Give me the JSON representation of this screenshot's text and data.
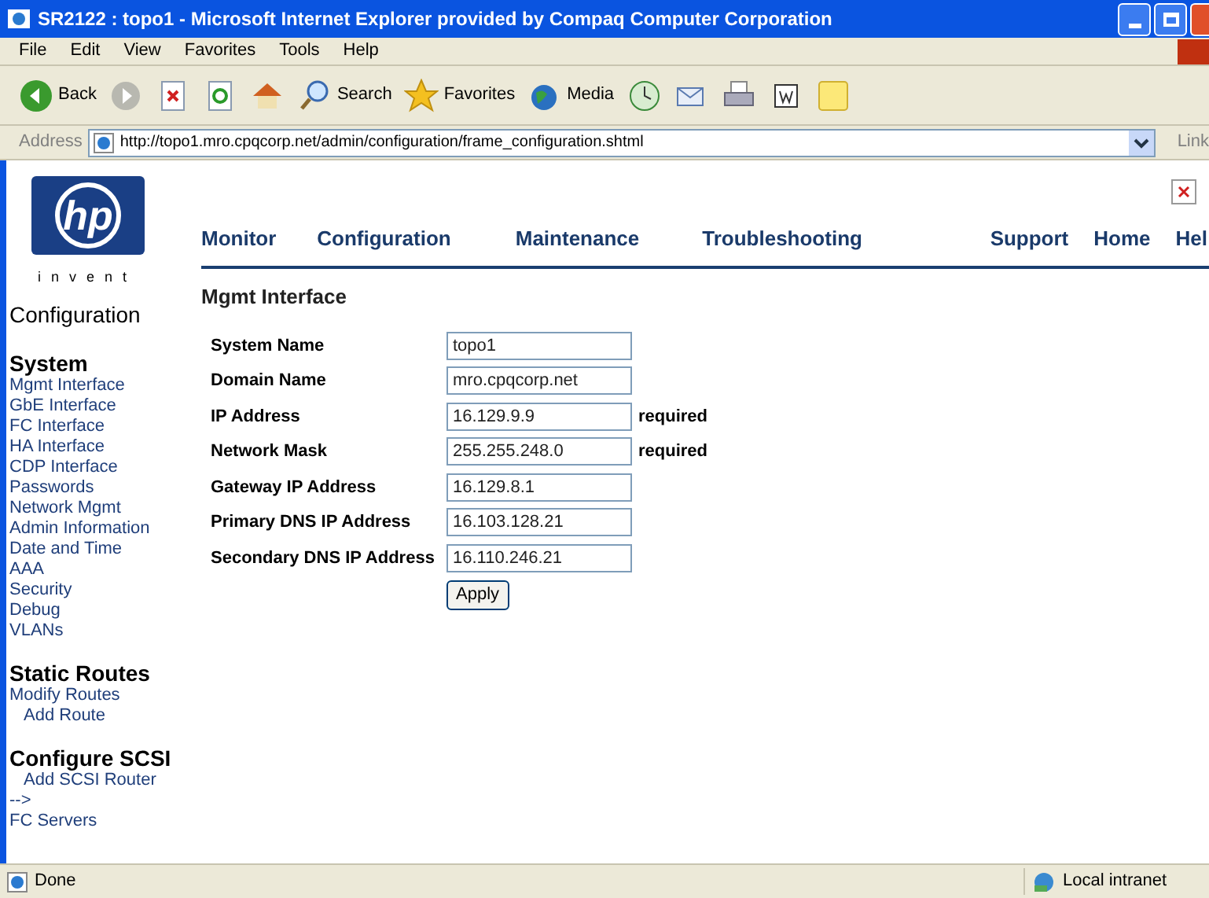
{
  "window": {
    "title": "SR2122 : topo1 - Microsoft Internet Explorer provided by Compaq Computer Corporation"
  },
  "menu_bar": [
    "File",
    "Edit",
    "View",
    "Favorites",
    "Tools",
    "Help"
  ],
  "toolbar": [
    {
      "kind": "back",
      "label": "Back"
    },
    {
      "kind": "forward"
    },
    {
      "kind": "stop"
    },
    {
      "kind": "refresh"
    },
    {
      "kind": "home"
    },
    {
      "kind": "search",
      "label": "Search"
    },
    {
      "kind": "favorites",
      "label": "Favorites"
    },
    {
      "kind": "media",
      "label": "Media"
    },
    {
      "kind": "history"
    },
    {
      "kind": "mail"
    },
    {
      "kind": "print"
    },
    {
      "kind": "word"
    },
    {
      "kind": "note"
    }
  ],
  "address_bar": {
    "label": "Address",
    "url": "http://topo1.mro.cpqcorp.net/admin/configuration/frame_configuration.shtml",
    "links": "Link"
  },
  "page": {
    "logo": {
      "mark": "hp",
      "tagline": "i n v e n t"
    },
    "nav": [
      "Monitor",
      "Configuration",
      "Maintenance",
      "Troubleshooting"
    ],
    "nav_right": [
      "Support",
      "Home",
      "Hel"
    ],
    "sidebar": {
      "heading": "Configuration",
      "sections": [
        {
          "title": "System",
          "items": [
            {
              "kind": "link",
              "label": "Mgmt Interface"
            },
            {
              "kind": "link",
              "label": "GbE Interface"
            },
            {
              "kind": "link",
              "label": "FC Interface"
            },
            {
              "kind": "link",
              "label": "HA Interface"
            },
            {
              "kind": "link",
              "label": "CDP Interface"
            },
            {
              "kind": "link",
              "label": "Passwords"
            },
            {
              "kind": "link",
              "label": "Network Mgmt"
            },
            {
              "kind": "link",
              "label": "Admin Information"
            },
            {
              "kind": "link",
              "label": "Date and Time"
            },
            {
              "kind": "link",
              "label": "AAA"
            },
            {
              "kind": "link",
              "label": "Security"
            },
            {
              "kind": "link",
              "label": "Debug"
            },
            {
              "kind": "link",
              "label": "VLANs"
            }
          ]
        },
        {
          "title": "Static Routes",
          "items": [
            {
              "kind": "link",
              "label": "Modify Routes",
              "children": [
                {
                  "kind": "link",
                  "label": "Add Route"
                }
              ]
            }
          ]
        },
        {
          "title": "Configure SCSI",
          "items": [
            {
              "kind": "sub",
              "label": "Add SCSI Router"
            },
            {
              "kind": "link",
              "label": "-->"
            },
            {
              "kind": "link",
              "label": "FC Servers"
            }
          ]
        }
      ]
    },
    "content": {
      "heading": "Mgmt Interface",
      "fields": [
        {
          "label": "System Name",
          "value": "topo1"
        },
        {
          "label": "Domain Name",
          "value": "mro.cpqcorp.net"
        },
        {
          "label": "IP Address",
          "value": "16.129.9.9",
          "note": "required"
        },
        {
          "label": "Network Mask",
          "value": "255.255.248.0",
          "note": "required"
        },
        {
          "label": "Gateway IP Address",
          "value": "16.129.8.1"
        },
        {
          "label": "Primary DNS IP Address",
          "value": "16.103.128.21"
        },
        {
          "label": "Secondary DNS IP Address",
          "value": "16.110.246.21"
        }
      ],
      "button": "Apply"
    }
  },
  "status_bar": {
    "text": "Done",
    "zone": "Local intranet"
  }
}
